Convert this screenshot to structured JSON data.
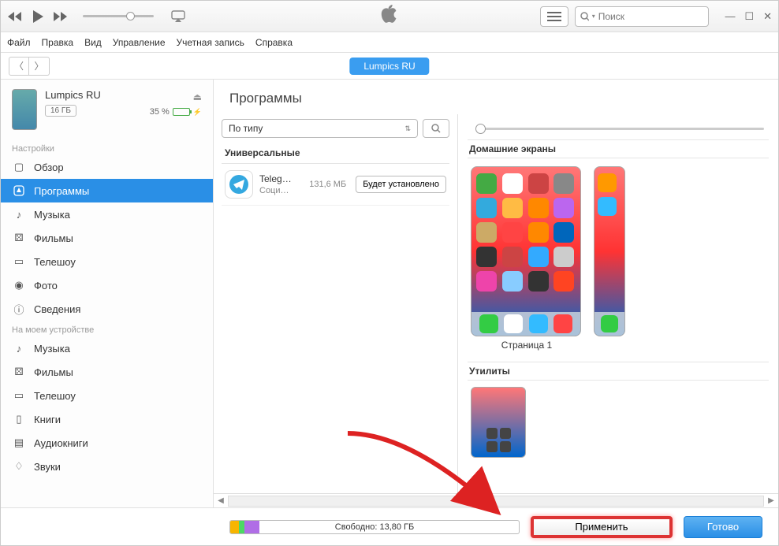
{
  "titlebar": {
    "search_placeholder": "Поиск"
  },
  "menubar": {
    "file": "Файл",
    "edit": "Правка",
    "view": "Вид",
    "controls": "Управление",
    "account": "Учетная запись",
    "help": "Справка"
  },
  "device_pill": "Lumpics RU",
  "sidebar": {
    "device": {
      "name": "Lumpics RU",
      "capacity": "16 ГБ",
      "battery": "35 %"
    },
    "section_settings": "Настройки",
    "section_on_device": "На моем устройстве",
    "items_settings": [
      {
        "label": "Обзор"
      },
      {
        "label": "Программы"
      },
      {
        "label": "Музыка"
      },
      {
        "label": "Фильмы"
      },
      {
        "label": "Телешоу"
      },
      {
        "label": "Фото"
      },
      {
        "label": "Сведения"
      }
    ],
    "items_device": [
      {
        "label": "Музыка"
      },
      {
        "label": "Фильмы"
      },
      {
        "label": "Телешоу"
      },
      {
        "label": "Книги"
      },
      {
        "label": "Аудиокниги"
      },
      {
        "label": "Звуки"
      }
    ]
  },
  "main": {
    "title": "Программы",
    "filter": "По типу",
    "section_universal": "Универсальные",
    "app": {
      "name": "Teleg…",
      "category": "Соци…",
      "size": "131,6 МБ",
      "action": "Будет установлено"
    },
    "section_home": "Домашние экраны",
    "page_label": "Страница 1",
    "section_util": "Утилиты"
  },
  "footer": {
    "free_label": "Свободно: 13,80 ГБ",
    "apply": "Применить",
    "done": "Готово"
  }
}
